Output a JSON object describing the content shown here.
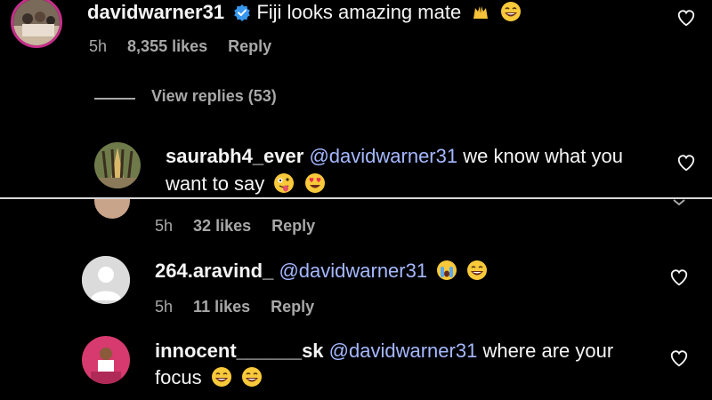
{
  "comments": [
    {
      "username": "davidwarner31",
      "verified": true,
      "text": "Fiji looks amazing mate",
      "emojis": [
        "raised-hands-emoji",
        "laughing-emoji"
      ],
      "time": "5h",
      "likes": "8,355 likes",
      "reply": "Reply"
    },
    {
      "username": "saurabh4_ever",
      "mention": "@davidwarner31",
      "text_line1": "we know what you",
      "text_line2": "want to say",
      "emojis": [
        "zany-face-emoji",
        "heart-eyes-emoji"
      ]
    },
    {
      "time": "5h",
      "likes": "32 likes",
      "reply": "Reply"
    },
    {
      "username": "264.aravind_",
      "mention": "@davidwarner31",
      "emojis": [
        "crying-emoji",
        "laughing-emoji"
      ],
      "time": "5h",
      "likes": "11 likes",
      "reply": "Reply"
    },
    {
      "username": "innocent______sk",
      "mention": "@davidwarner31",
      "text_line1": "where are your",
      "text_line2": "focus",
      "emojis": [
        "laughing-emoji",
        "laughing-emoji"
      ]
    }
  ],
  "view_replies": "View replies (53)",
  "colors": {
    "background": "#000000",
    "text": "#f5f5f5",
    "meta": "#a8a8a8",
    "mention": "#a6b8ff",
    "verified": "#3797f0"
  }
}
